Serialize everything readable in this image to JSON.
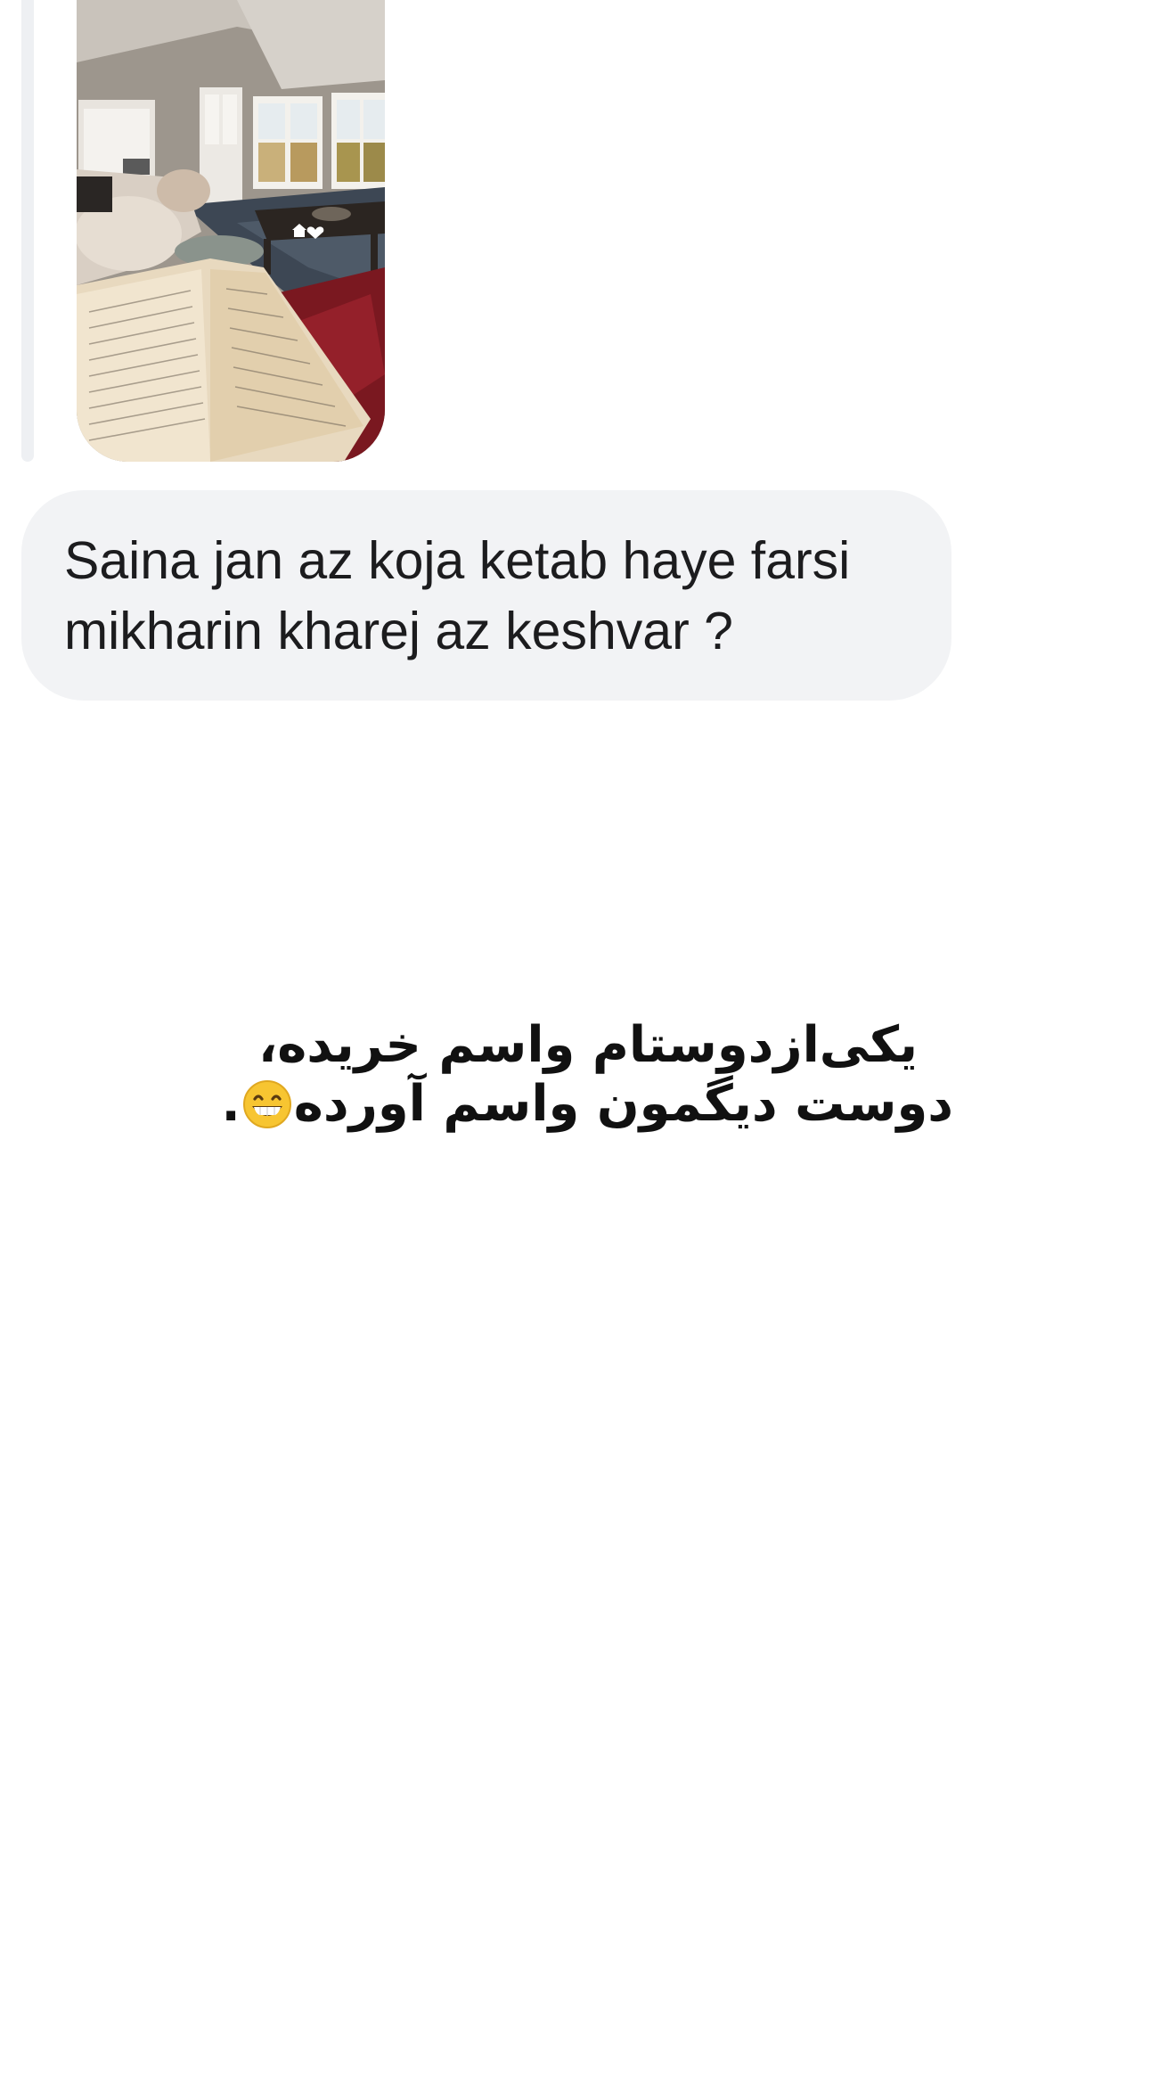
{
  "conversation": {
    "shared_story": {
      "accent": "#eef0f3",
      "thumbnail_icons": [
        "house-icon",
        "heart-icon"
      ]
    },
    "message": {
      "text": "Saina jan az koja ketab haye farsi mikharin kharej az keshvar ?",
      "bubble_color": "#f2f3f5"
    }
  },
  "caption": {
    "line1": "یکی‌ازدوستام واسم خریده،",
    "line2": "دوست دیگمون واسم آورده",
    "line2_end": ".",
    "emoji_icon": "grinning-face-icon"
  }
}
